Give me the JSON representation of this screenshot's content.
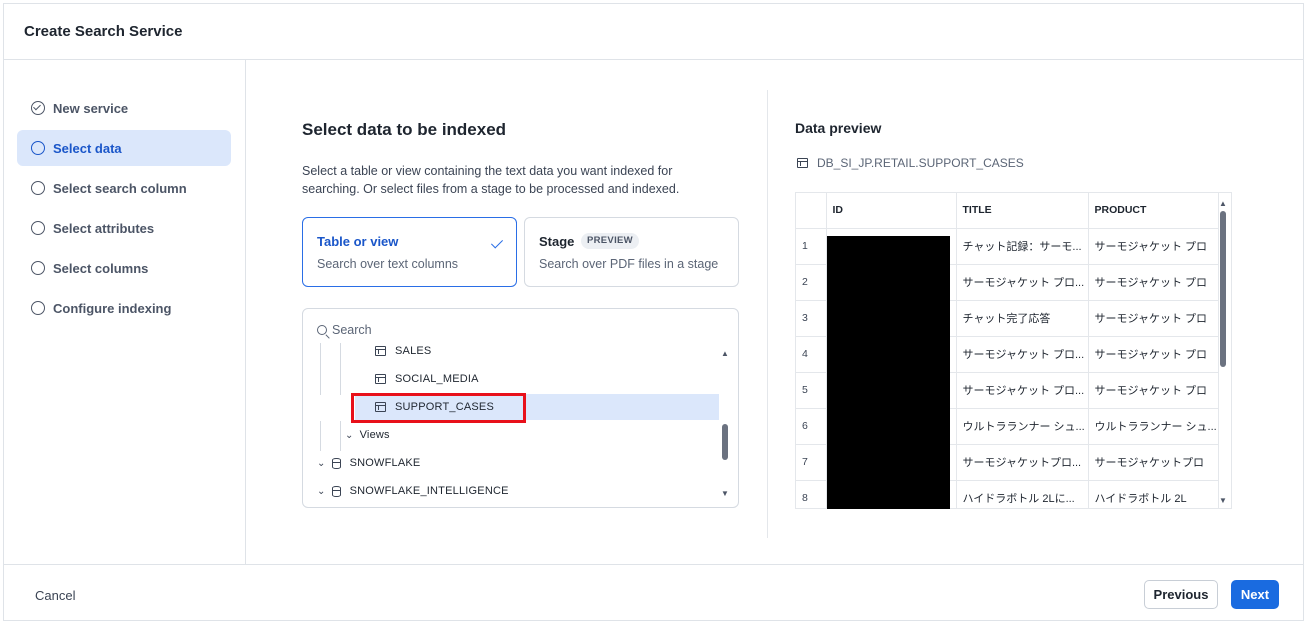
{
  "dialog": {
    "title": "Create Search Service"
  },
  "steps": [
    {
      "label": "New service",
      "state": "done"
    },
    {
      "label": "Select data",
      "state": "active"
    },
    {
      "label": "Select search column",
      "state": "todo"
    },
    {
      "label": "Select attributes",
      "state": "todo"
    },
    {
      "label": "Select columns",
      "state": "todo"
    },
    {
      "label": "Configure indexing",
      "state": "todo"
    }
  ],
  "main": {
    "title": "Select data to be indexed",
    "description": "Select a table or view containing the text data you want indexed for searching. Or select files from a stage to be processed and indexed.",
    "options": [
      {
        "title": "Table or view",
        "desc": "Search over text columns",
        "selected": true
      },
      {
        "title": "Stage",
        "badge": "PREVIEW",
        "desc": "Search over PDF files in a stage",
        "selected": false
      }
    ],
    "tree": {
      "search_placeholder": "Search",
      "items": [
        {
          "label": "SALES",
          "type": "table"
        },
        {
          "label": "SOCIAL_MEDIA",
          "type": "table"
        },
        {
          "label": "SUPPORT_CASES",
          "type": "table",
          "selected": true
        },
        {
          "label": "Views",
          "type": "folder"
        },
        {
          "label": "SNOWFLAKE",
          "type": "database"
        },
        {
          "label": "SNOWFLAKE_INTELLIGENCE",
          "type": "database"
        }
      ]
    }
  },
  "preview": {
    "title": "Data preview",
    "path": "DB_SI_JP.RETAIL.SUPPORT_CASES",
    "columns": [
      "ID",
      "TITLE",
      "PRODUCT"
    ],
    "rows": [
      {
        "n": "1",
        "title": "チャット記録：サーモ...",
        "product": "サーモジャケット プロ"
      },
      {
        "n": "2",
        "title": "サーモジャケット プロ...",
        "product": "サーモジャケット プロ"
      },
      {
        "n": "3",
        "title": "チャット完了応答",
        "product": "サーモジャケット プロ"
      },
      {
        "n": "4",
        "title": "サーモジャケット プロ...",
        "product": "サーモジャケット プロ"
      },
      {
        "n": "5",
        "title": "サーモジャケット プロ...",
        "product": "サーモジャケット プロ"
      },
      {
        "n": "6",
        "title": "ウルトラランナー シュ...",
        "product": "ウルトラランナー シュ..."
      },
      {
        "n": "7",
        "title": "サーモジャケットプロ...",
        "product": "サーモジャケットプロ"
      },
      {
        "n": "8",
        "title": "ハイドラボトル 2Lに...",
        "product": "ハイドラボトル 2L"
      }
    ]
  },
  "footer": {
    "cancel": "Cancel",
    "previous": "Previous",
    "next": "Next"
  }
}
